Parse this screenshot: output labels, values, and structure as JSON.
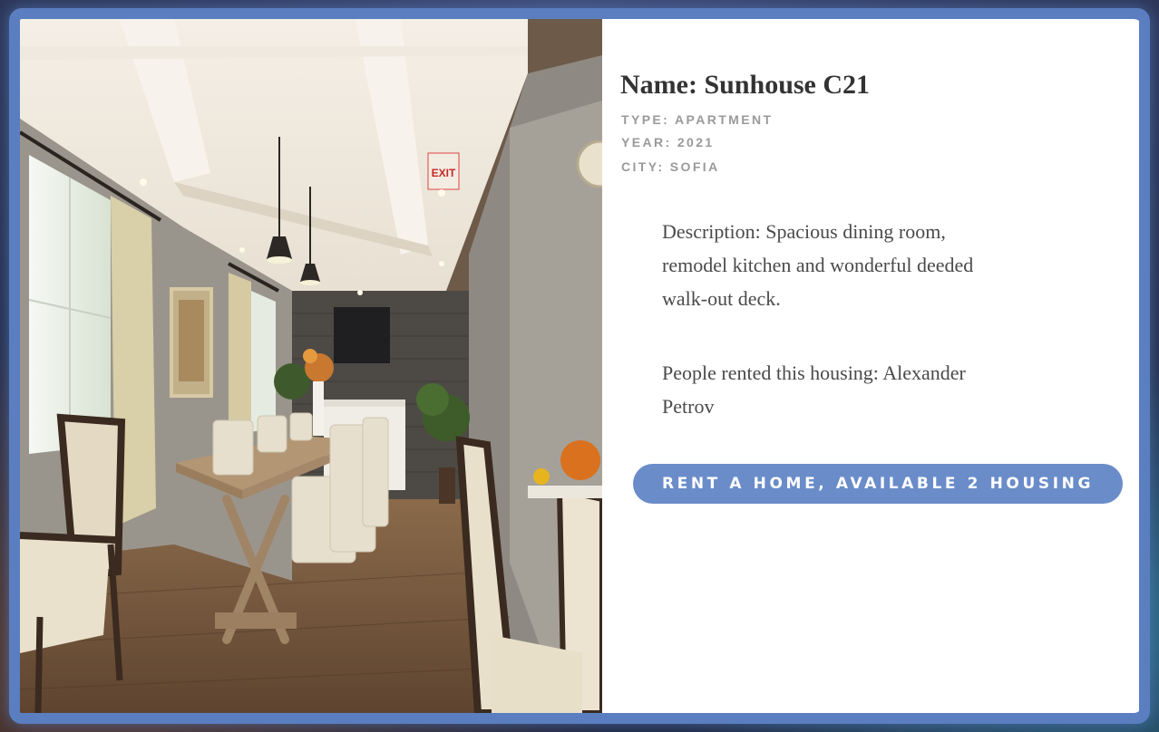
{
  "listing": {
    "title": "Name: Sunhouse C21",
    "type": "Type: Apartment",
    "year": "Year: 2021",
    "city": "City: Sofia",
    "description": "Description: Spacious dining room, remodel kitchen and wonderful deeded walk-out deck.",
    "renters": "People rented this housing: Alexander Petrov",
    "rent_button_label": "Rent a home, available 2 housing",
    "exit_sign_text": "EXIT"
  },
  "colors": {
    "frame": "#5a7ec0",
    "button": "#6a8cc9",
    "title_text": "#333333",
    "meta_text": "#9a9a9a",
    "body_text": "#4a4a4a"
  }
}
